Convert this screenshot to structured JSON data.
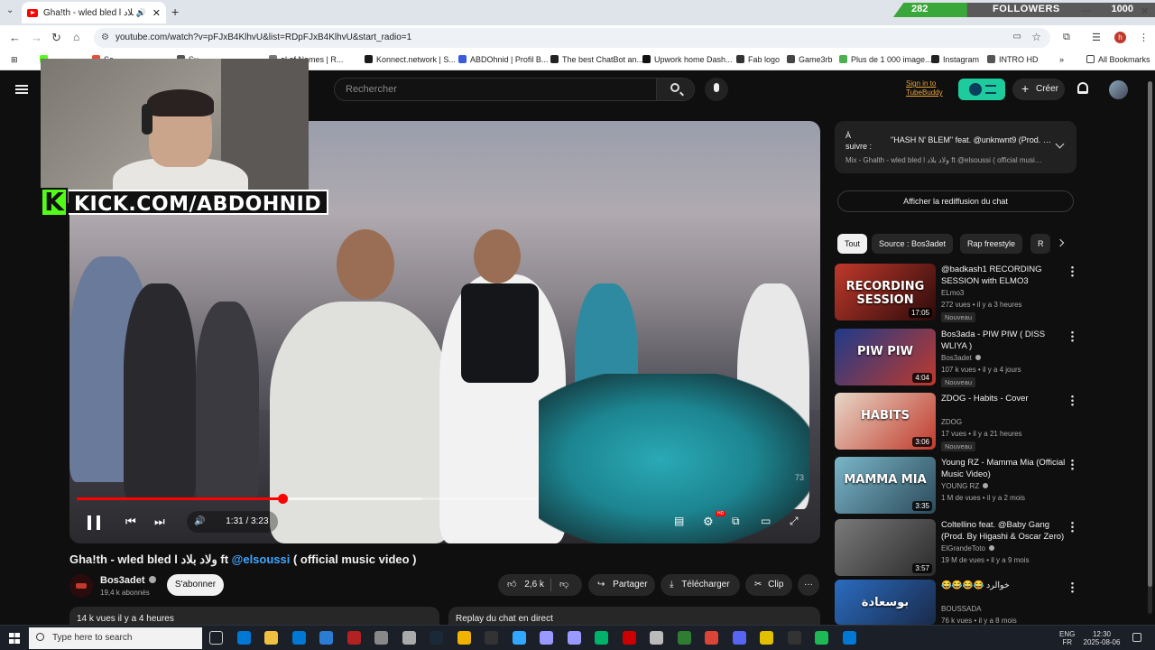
{
  "browser": {
    "tab_title": "Gha!th - wled bled l ولاد بلاد",
    "new_tab": "+",
    "close_tab": "✕",
    "url": "youtube.com/watch?v=pFJxB4KlhvU&list=RDpFJxB4KlhvU&start_radio=1",
    "win_min": "—",
    "win_close": "✕",
    "bookmarks": [
      {
        "label": "",
        "color": "#53fc18"
      },
      {
        "label": "Se",
        "color": "#e74c3c"
      },
      {
        "label": "Su",
        "color": "#555555"
      },
      {
        "label": "el of Names | R...",
        "color": "#777777"
      },
      {
        "label": "Konnect.network | S...",
        "color": "#1a1a1a"
      },
      {
        "label": "ABDOhnid | Profil B...",
        "color": "#3b5bdb"
      },
      {
        "label": "The best ChatBot an...",
        "color": "#222222"
      },
      {
        "label": "Upwork home Dash...",
        "color": "#111111"
      },
      {
        "label": "Fab logo",
        "color": "#333333"
      },
      {
        "label": "Game3rb",
        "color": "#444444"
      },
      {
        "label": "Plus de 1 000 image...",
        "color": "#4caf50"
      },
      {
        "label": "Instagram",
        "color": "#222222"
      },
      {
        "label": "INTRO HD",
        "color": "#555555"
      }
    ],
    "all_bookmarks": "All Bookmarks"
  },
  "followers_widget": {
    "count": "282",
    "label": "FOLLOWERS",
    "goal": "1000",
    "fraction": 0.282
  },
  "youtube": {
    "search_placeholder": "Rechercher",
    "tubebuddy_line1": "Sign in to",
    "tubebuddy_line2": "TubeBuddy",
    "create_label": "Créer",
    "create_plus": "+",
    "player": {
      "current_time": "1:31",
      "duration": "3:23",
      "time_sep": " / ",
      "progress_fraction": 0.448,
      "buffer_fraction": 0.75,
      "watermark": "73",
      "settings_badge": "HD"
    },
    "stream_overlay": {
      "kick_letter": "K",
      "kick_url": "KICK.COM/ABDOHNID"
    },
    "video": {
      "title_main": "Gha!th - wled bled l ولاد بلاد ft ",
      "title_mention": "@elsoussi",
      "title_tail": " ( official music video )",
      "channel": "Bos3adet",
      "subscribers": "19,4 k abonnés",
      "subscribe_label": "S'abonner",
      "likes": "2,6 k",
      "share_label": "Partager",
      "download_label": "Télécharger",
      "clip_label": "Clip",
      "more_label": "···",
      "views_time": "14 k vues  il y a 4 heures",
      "chat_replay_header": "Replay du chat en direct"
    },
    "up_next": {
      "label_line1": "À",
      "label_line2": "suivre :",
      "title": "\"HASH N' BLEM\" feat. @unknwnt9 (Prod. b...",
      "subtitle": "Mix - Ghalth - wled bled l ولاد بلاد ft @elsoussi ( official music ..."
    },
    "chat_replay_button": "Afficher la rediffusion du chat",
    "chips": [
      "Tout",
      "Source : Bos3adet",
      "Rap freestyle",
      "R"
    ],
    "recommendations": [
      {
        "title": "@badkash1  RECORDING SESSION with ELMO3",
        "channel": "ELmo3",
        "verified": false,
        "meta": "272 vues • il y a 3 heures",
        "badge": "Nouveau",
        "duration": "17:05",
        "thumb_a": "#c0392b",
        "thumb_b": "#2a0a0a",
        "thumb_text": "RECORDING SESSION"
      },
      {
        "title": "Bos3ada - PIW PIW ( DISS WLIYA )",
        "channel": "Bos3adet",
        "verified": true,
        "meta": "107 k vues • il y a 4 jours",
        "badge": "Nouveau",
        "duration": "4:04",
        "thumb_a": "#1e3a8a",
        "thumb_b": "#c0392b",
        "thumb_text": "PIW PIW"
      },
      {
        "title": "ZDOG - Habits - Cover",
        "channel": "ZDOG",
        "verified": false,
        "meta": "17 vues • il y a 21 heures",
        "badge": "Nouveau",
        "duration": "3:06",
        "thumb_a": "#e8d8c8",
        "thumb_b": "#c0392b",
        "thumb_text": "HABITS"
      },
      {
        "title": "Young RZ - Mamma Mia (Official Music Video)",
        "channel": "YOUNG RZ",
        "verified": true,
        "meta": "1 M de vues • il y a 2 mois",
        "badge": "",
        "duration": "3:35",
        "thumb_a": "#7ab6c8",
        "thumb_b": "#2b4a5a",
        "thumb_text": "MAMMA MIA"
      },
      {
        "title": "Coltellino feat. @Baby Gang (Prod. By Higashi & Oscar Zero)",
        "channel": "ElGrandeToto",
        "verified": true,
        "meta": "19 M de vues • il y a 9 mois",
        "badge": "",
        "duration": "3:57",
        "thumb_a": "#7a7a7a",
        "thumb_b": "#2a2a2a",
        "thumb_text": ""
      },
      {
        "title": "😂😂😂😂 خوالرد",
        "channel": "BOUSSADA",
        "verified": false,
        "meta": "76 k vues • il y a 8 mois",
        "badge": "",
        "duration": "",
        "thumb_a": "#2a6cc0",
        "thumb_b": "#1a2a4a",
        "thumb_text": "بوسعادة"
      }
    ]
  },
  "taskbar": {
    "search_placeholder": "Type here to search",
    "lang_line1": "ENG",
    "lang_line2": "FR",
    "time": "12:30",
    "date": "2025-08-06",
    "apps": [
      "#6264a7",
      "#0078d4",
      "#f0c040",
      "#0078d4",
      "#2b7cd3",
      "#b22222",
      "#888888",
      "#aaaaaa",
      "#1b2838",
      "#f0b400",
      "#333333",
      "#31a8ff",
      "#9999ff",
      "#9999ff",
      "#00b36b",
      "#cc0000",
      "#bbbbbb",
      "#2e7d32",
      "#db4437",
      "#5865f2",
      "#e0c000",
      "#333333",
      "#1db954",
      "#0078d4"
    ]
  }
}
